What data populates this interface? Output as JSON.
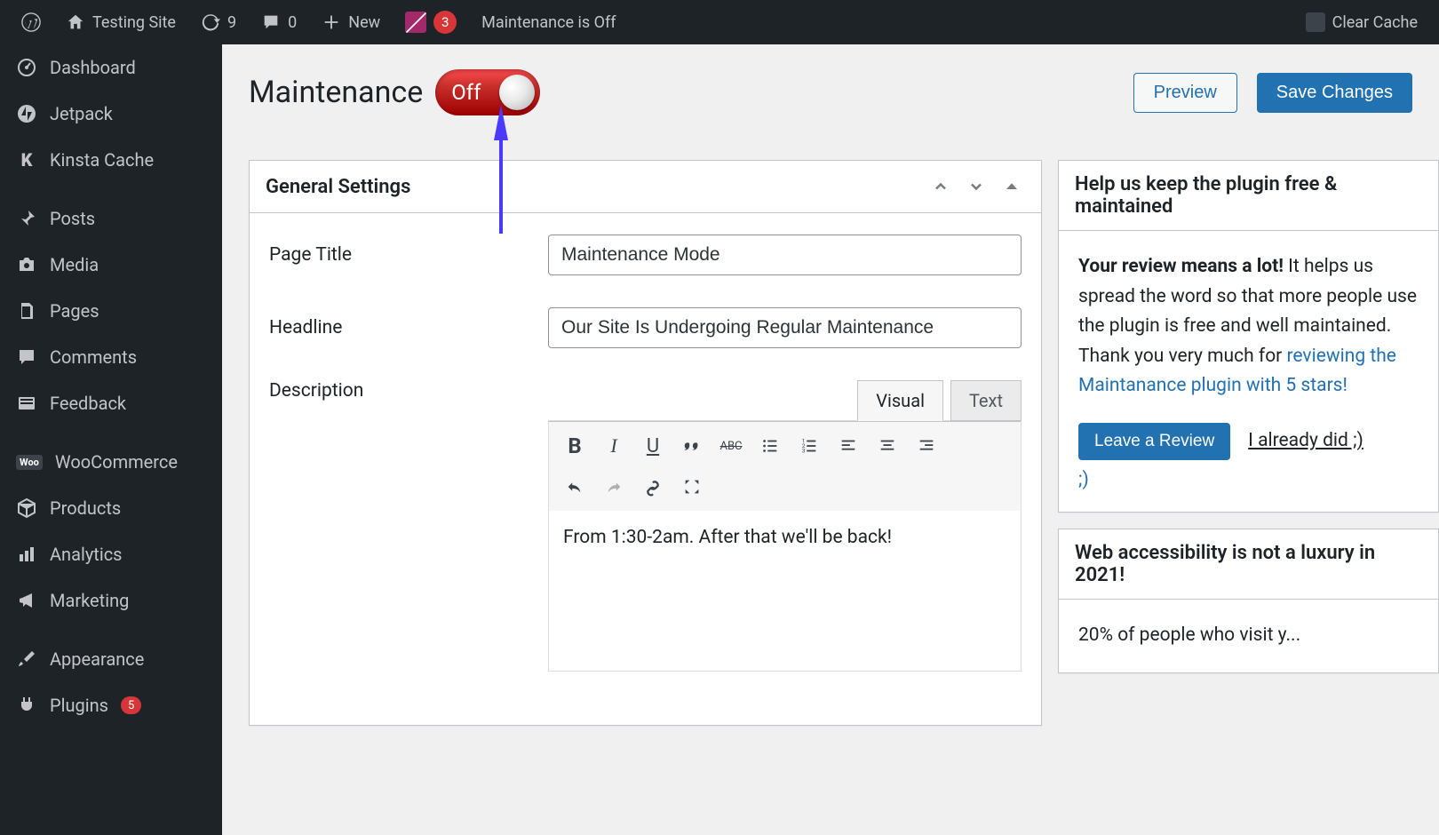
{
  "adminbar": {
    "site_name": "Testing Site",
    "updates": "9",
    "comments": "0",
    "new": "New",
    "yoast_count": "3",
    "maintenance": "Maintenance is Off",
    "clear_cache": "Clear Cache"
  },
  "sidebar": {
    "dashboard": "Dashboard",
    "jetpack": "Jetpack",
    "kinsta": "Kinsta Cache",
    "posts": "Posts",
    "media": "Media",
    "pages": "Pages",
    "comments": "Comments",
    "feedback": "Feedback",
    "woocommerce": "WooCommerce",
    "products": "Products",
    "analytics": "Analytics",
    "marketing": "Marketing",
    "appearance": "Appearance",
    "plugins": "Plugins",
    "plugins_badge": "5"
  },
  "header": {
    "title": "Maintenance",
    "toggle_label": "Off",
    "preview": "Preview",
    "save": "Save Changes"
  },
  "postbox": {
    "title": "General Settings",
    "labels": {
      "page_title": "Page Title",
      "headline": "Headline",
      "description": "Description"
    },
    "values": {
      "page_title": "Maintenance Mode",
      "headline": "Our Site Is Undergoing Regular Maintenance",
      "description": "From 1:30-2am. After that we'll be back!"
    },
    "editor_tabs": {
      "visual": "Visual",
      "text": "Text"
    }
  },
  "side1": {
    "title": "Help us keep the plugin free & maintained",
    "bold": "Your review means a lot!",
    "line1": " It helps us spread the word so that more people use the plugin is free and well maintained. Thank you very much for ",
    "link1": "reviewing the",
    "link2": "Maintanance plugin with 5 stars!",
    "btn": "Leave a Review",
    "already": "I already did ;)"
  },
  "side2": {
    "title": "Web accessibility is not a luxury in 2021!",
    "line": "20% of people who visit y..."
  }
}
